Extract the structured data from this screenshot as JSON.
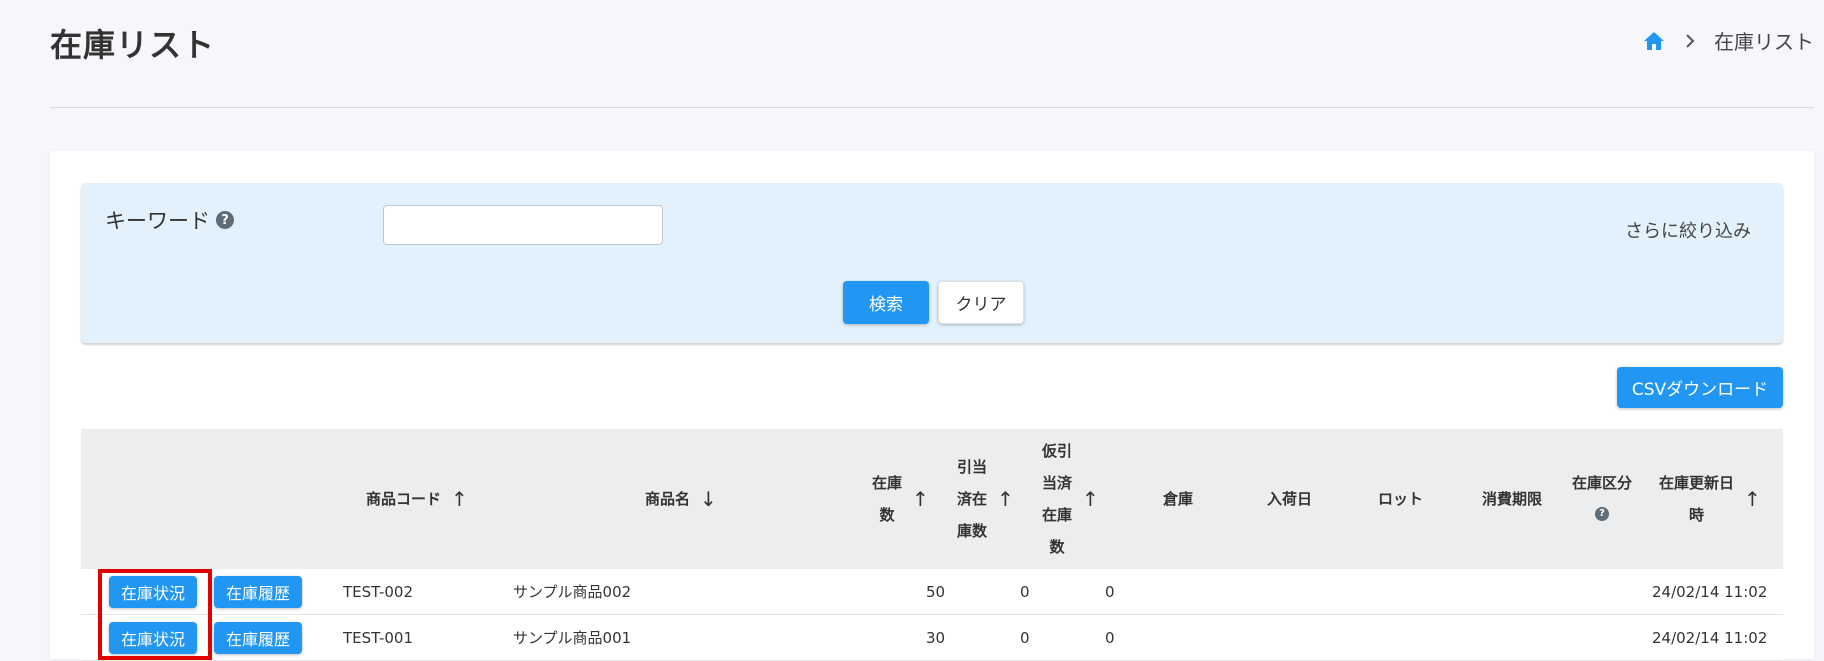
{
  "page": {
    "title": "在庫リスト"
  },
  "breadcrumb": {
    "current": "在庫リスト"
  },
  "search": {
    "keyword_label": "キーワード",
    "help": "?",
    "keyword_value": "",
    "more_filters": "さらに絞り込み",
    "search_label": "検索",
    "clear_label": "クリア"
  },
  "toolbar": {
    "csv_label": "CSVダウンロード"
  },
  "table": {
    "headers": {
      "product_code": "商品コード",
      "product_name": "商品名",
      "stock_qty": [
        "在庫",
        "数"
      ],
      "allocated_qty": [
        "引当",
        "済在",
        "庫数"
      ],
      "temp_allocated_qty": [
        "仮引",
        "当済",
        "在庫",
        "数"
      ],
      "warehouse": "倉庫",
      "arrival_date": "入荷日",
      "lot": "ロット",
      "expiry": "消費期限",
      "stock_type": "在庫区分",
      "updated_at": [
        "在庫更新日",
        "時"
      ]
    },
    "sort_arrows": {
      "up": "↑",
      "down": "↓"
    },
    "rows": [
      {
        "status_btn": "在庫状況",
        "history_btn": "在庫履歴",
        "code": "TEST-002",
        "name": "サンプル商品002",
        "stock": "50",
        "allocated": "0",
        "temp": "0",
        "updated": "24/02/14 11:02"
      },
      {
        "status_btn": "在庫状況",
        "history_btn": "在庫履歴",
        "code": "TEST-001",
        "name": "サンプル商品001",
        "stock": "30",
        "allocated": "0",
        "temp": "0",
        "updated": "24/02/14 11:02"
      }
    ]
  },
  "colors": {
    "primary": "#2196f3",
    "panel": "#e3f1fc",
    "highlight": "#e00000"
  },
  "icons": {
    "home": "home-icon",
    "chevron": "chevron-right-icon",
    "help": "help-circle-icon"
  }
}
